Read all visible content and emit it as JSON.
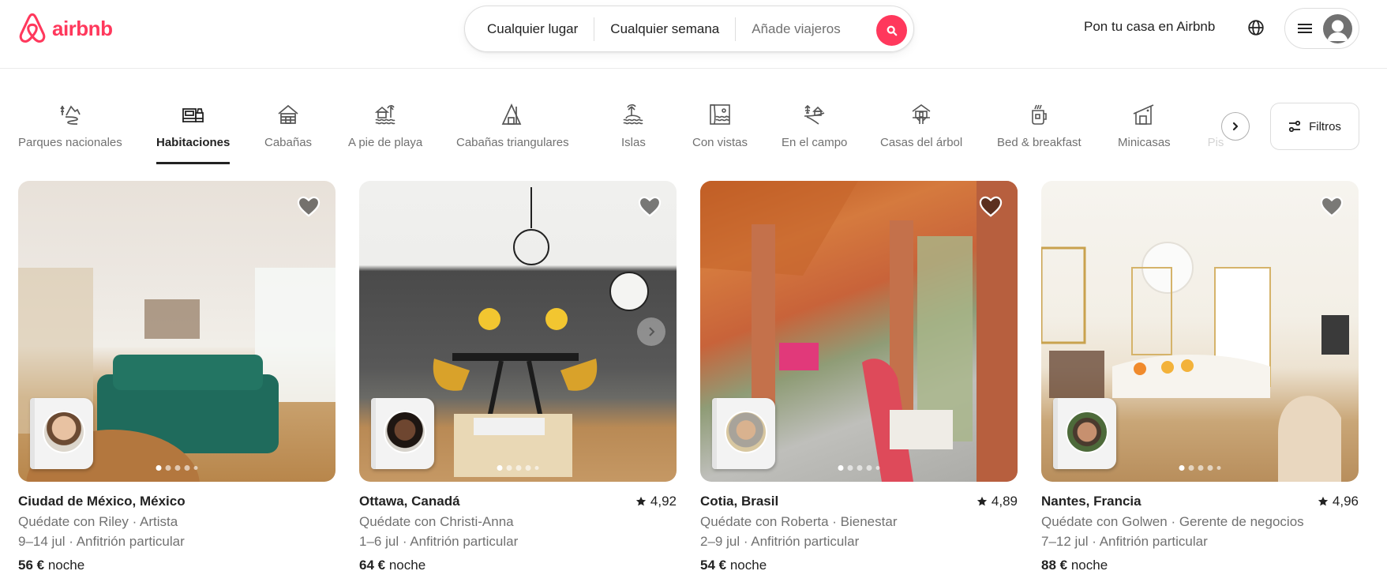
{
  "brand": {
    "name": "airbnb",
    "color": "#ff385c"
  },
  "search": {
    "location": "Cualquier lugar",
    "dates": "Cualquier semana",
    "guests_placeholder": "Añade viajeros",
    "button_icon": "search-icon"
  },
  "header": {
    "host_link": "Pon tu casa en Airbnb",
    "language_icon": "globe-icon",
    "menu_icon": "hamburger-menu-icon",
    "profile_icon": "user-avatar-icon"
  },
  "categories": {
    "active_index": 1,
    "items": [
      {
        "label": "Parques nacionales",
        "icon": "national-park-icon"
      },
      {
        "label": "Habitaciones",
        "icon": "bedroom-icon"
      },
      {
        "label": "Cabañas",
        "icon": "cabin-icon"
      },
      {
        "label": "A pie de playa",
        "icon": "beachfront-icon"
      },
      {
        "label": "Cabañas triangulares",
        "icon": "a-frame-icon"
      },
      {
        "label": "Islas",
        "icon": "island-icon"
      },
      {
        "label": "Con vistas",
        "icon": "amazing-views-icon"
      },
      {
        "label": "En el campo",
        "icon": "countryside-icon"
      },
      {
        "label": "Casas del árbol",
        "icon": "treehouse-icon"
      },
      {
        "label": "Bed & breakfast",
        "icon": "bed-and-breakfast-icon"
      },
      {
        "label": "Minicasas",
        "icon": "tiny-home-icon"
      },
      {
        "label": "Pis",
        "icon": ""
      }
    ],
    "next_icon": "chevron-right-icon",
    "filters_label": "Filtros",
    "filters_icon": "filters-icon"
  },
  "listings": [
    {
      "title": "Ciudad de México, México",
      "rating": "",
      "host_line": "Quédate con Riley · Artista",
      "dates_line": "9–14 jul · Anfitrión particular",
      "price": "56 €",
      "price_unit": "noche",
      "photo_count": 5,
      "current_photo": 1
    },
    {
      "title": "Ottawa, Canadá",
      "rating": "4,92",
      "host_line": "Quédate con Christi-Anna",
      "dates_line": "1–6 jul · Anfitrión particular",
      "price": "64 €",
      "price_unit": "noche",
      "photo_count": 5,
      "current_photo": 1
    },
    {
      "title": "Cotia, Brasil",
      "rating": "4,89",
      "host_line": "Quédate con Roberta · Bienestar",
      "dates_line": "2–9 jul · Anfitrión particular",
      "price": "54 €",
      "price_unit": "noche",
      "photo_count": 5,
      "current_photo": 1
    },
    {
      "title": "Nantes, Francia",
      "rating": "4,96",
      "host_line": "Quédate con Golwen · Gerente de negocios",
      "dates_line": "7–12 jul · Anfitrión particular",
      "price": "88 €",
      "price_unit": "noche",
      "photo_count": 5,
      "current_photo": 1
    }
  ]
}
